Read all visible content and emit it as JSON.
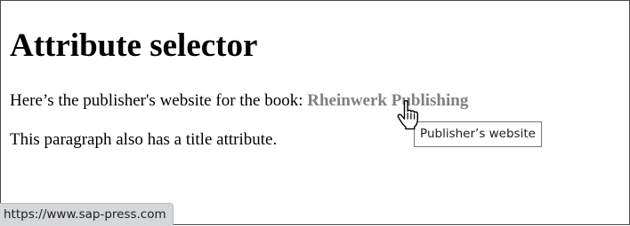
{
  "heading": "Attribute selector",
  "paragraph_1": {
    "text": "Here’s the publisher's website for the book: ",
    "link_text": "Rheinwerk Publishing",
    "link_title": "Publisher’s website",
    "link_href": "https://www.sap-press.com"
  },
  "paragraph_2": {
    "text": "This paragraph also has a title attribute."
  },
  "tooltip": {
    "text": "Publisher’s website"
  },
  "status_bar": {
    "url": "https://www.sap-press.com"
  },
  "cursor": {
    "icon": "hand-pointer-icon"
  },
  "colors": {
    "link": "#808080",
    "tooltip_border": "#767676",
    "status_bar_bg": "#d6d7da"
  }
}
